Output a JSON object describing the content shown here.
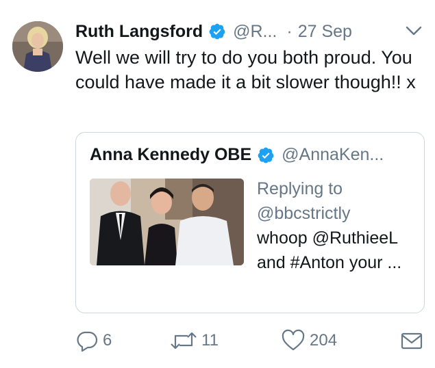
{
  "tweet": {
    "author_name": "Ruth Langsford",
    "handle": "@R...",
    "separator": "·",
    "date": "27 Sep",
    "text": "Well we will try to do you both proud. You could have made it a bit slower though!! x"
  },
  "quoted_tweet": {
    "author_name": "Anna Kennedy OBE",
    "handle": "@AnnaKen...",
    "replying_to_label": "Replying to",
    "replying_to": "@bbcstrictly",
    "text": "whoop @RuthieeL and #Anton your ..."
  },
  "actions": {
    "reply_count": "6",
    "retweet_count": "11",
    "like_count": "204"
  },
  "colors": {
    "verified_blue": "#1da1f2",
    "secondary_text": "#657786",
    "border": "#ccd6dd"
  },
  "icons": [
    "chevron-down-icon",
    "verified-badge-icon",
    "reply-icon",
    "retweet-icon",
    "like-icon",
    "direct-message-icon"
  ]
}
